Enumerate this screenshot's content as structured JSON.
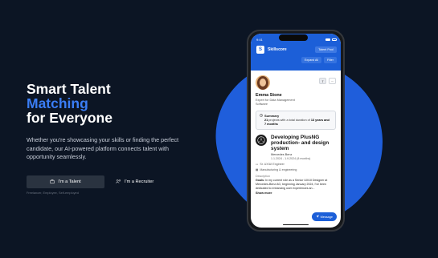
{
  "hero": {
    "headline_line1": "Smart Talent",
    "headline_accent": "Matching",
    "headline_line3": "for Everyone",
    "subtext": "Whether you're showcasing your skills or finding the perfect candidate, our AI-powered platform connects talent with opportunity seamlessly.",
    "cta_talent": "I'm a Talent",
    "cta_recruiter": "I'm a Recruiter",
    "cta_sub": "Freelancer, Employee, Self-employed"
  },
  "phone": {
    "time": "9:41",
    "brand": "Skillscore",
    "logo_letter": "S",
    "talent_pool": "Talent Pool",
    "expand_all": "Expand All",
    "filter": "Filter",
    "profile": {
      "name": "Emma Stone",
      "role": "Expert for Data Management",
      "role_line2": "Software"
    },
    "summary": {
      "title": "Summary",
      "count": "21",
      "text_mid": "projects with a total duration of",
      "duration": "13 years and 7 months"
    },
    "job": {
      "title": "Developing PlusNG production- and design system",
      "company": "Mercedes Benz",
      "dates": "1.1.2024 - 1.9.2024 (8 months)",
      "position": "Sr. UX/UI Engineer",
      "industry": "Manufacturing & engineering",
      "desc_label": "Description",
      "desc_prefix": "Goals:",
      "desc": "In my current role as a Senior UX/UI Designer at Mercedes-Benz AG, beginning January 2024, I've been dedicated to enhancing user experiences an...",
      "show_more": "Show more"
    },
    "message_btn": "Message"
  },
  "colors": {
    "background": "#0c1524",
    "accent": "#3a7df5",
    "blob": "#1f5edb",
    "app_header": "#1c5fd8"
  },
  "icons": [
    "briefcase-icon",
    "users-icon",
    "clock-icon",
    "send-icon",
    "more-icon",
    "share-icon"
  ]
}
